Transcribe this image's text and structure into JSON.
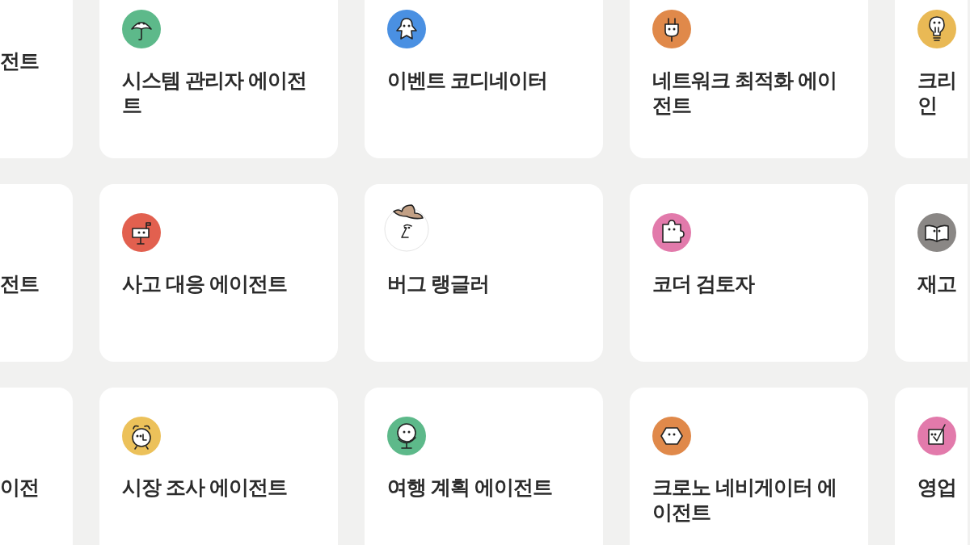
{
  "rows": [
    {
      "cards": [
        {
          "title": "전트"
        },
        {
          "title": "시스템 관리자 에이전트",
          "color": "#5db98a"
        },
        {
          "title": "이벤트 코디네이터",
          "color": "#4a90e2"
        },
        {
          "title": "네트워크 최적화 에이전트",
          "color": "#e0894a"
        },
        {
          "title": "크리 인",
          "color": "#e9b955"
        }
      ]
    },
    {
      "cards": [
        {
          "title": "전트"
        },
        {
          "title": "사고 대응 에이전트",
          "color": "#e2604f"
        },
        {
          "title": "버그 랭글러"
        },
        {
          "title": "코더 검토자",
          "color": "#e27aab"
        },
        {
          "title": "재고",
          "color": "#8a8785"
        }
      ]
    },
    {
      "cards": [
        {
          "title": "이전"
        },
        {
          "title": "시장 조사 에이전트",
          "color": "#ecc15a"
        },
        {
          "title": "여행 계획 에이전트",
          "color": "#5db98a"
        },
        {
          "title": "크로노 네비게이터 에이전트",
          "color": "#e0894a"
        },
        {
          "title": "영업",
          "color": "#e27aab"
        }
      ]
    }
  ]
}
